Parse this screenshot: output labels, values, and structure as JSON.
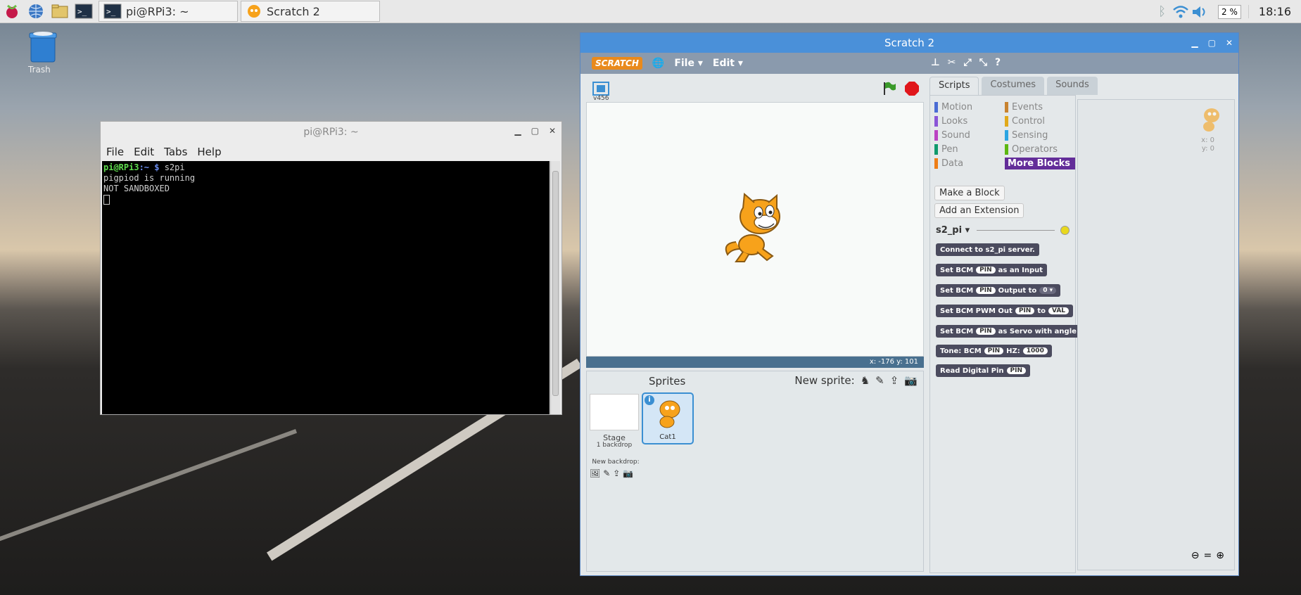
{
  "taskbar": {
    "terminal_task": "pi@RPi3: ~",
    "scratch_task": "Scratch 2",
    "cpu": "2 %",
    "clock": "18:16"
  },
  "desktop": {
    "trash_label": "Trash"
  },
  "terminal": {
    "title": "pi@RPi3: ~",
    "menu": [
      "File",
      "Edit",
      "Tabs",
      "Help"
    ],
    "prompt_user": "pi@RPi3",
    "prompt_path": ":~ $",
    "command": " s2pi",
    "lines": [
      "pigpiod is running",
      "NOT SANDBOXED"
    ]
  },
  "scratch": {
    "title": "Scratch 2",
    "logo": "SCRATCH",
    "menu": {
      "file": "File ▾",
      "edit": "Edit ▾"
    },
    "version": "v456",
    "coords": "x: -176  y: 101",
    "sprites_label": "Sprites",
    "new_sprite_label": "New sprite:",
    "stage_label": "Stage",
    "stage_backdrops": "1 backdrop",
    "new_backdrop_label": "New backdrop:",
    "sprite_name": "Cat1",
    "tabs": [
      "Scripts",
      "Costumes",
      "Sounds"
    ],
    "categories": [
      {
        "label": "Motion",
        "color": "#4a6cd4"
      },
      {
        "label": "Events",
        "color": "#c88330"
      },
      {
        "label": "Looks",
        "color": "#8a55d7"
      },
      {
        "label": "Control",
        "color": "#e1a91a"
      },
      {
        "label": "Sound",
        "color": "#bb42c3"
      },
      {
        "label": "Sensing",
        "color": "#2ca5e2"
      },
      {
        "label": "Pen",
        "color": "#0e9a6c"
      },
      {
        "label": "Operators",
        "color": "#5cb712"
      },
      {
        "label": "Data",
        "color": "#ee7d16"
      },
      {
        "label": "More Blocks",
        "color": "#632d99"
      }
    ],
    "make_block": "Make a Block",
    "add_extension": "Add an Extension",
    "extension_name": "s2_pi ▾",
    "blocks": {
      "b1": "Connect to s2_pi server.",
      "b2a": "Set BCM",
      "b2s": "PIN",
      "b2b": "as an Input",
      "b3a": "Set BCM",
      "b3s": "PIN",
      "b3b": "Output to",
      "b3v": "0 ▾",
      "b4a": "Set BCM PWM Out",
      "b4s": "PIN",
      "b4b": "to",
      "b4v": "VAL",
      "b5a": "Set BCM",
      "b5s": "PIN",
      "b5b": "as Servo with angle",
      "b6a": "Tone: BCM",
      "b6s": "PIN",
      "b6b": "HZ:",
      "b6v": "1000",
      "b7a": "Read Digital Pin",
      "b7s": "PIN"
    },
    "sprite_x": "x: 0",
    "sprite_y": "y: 0"
  }
}
